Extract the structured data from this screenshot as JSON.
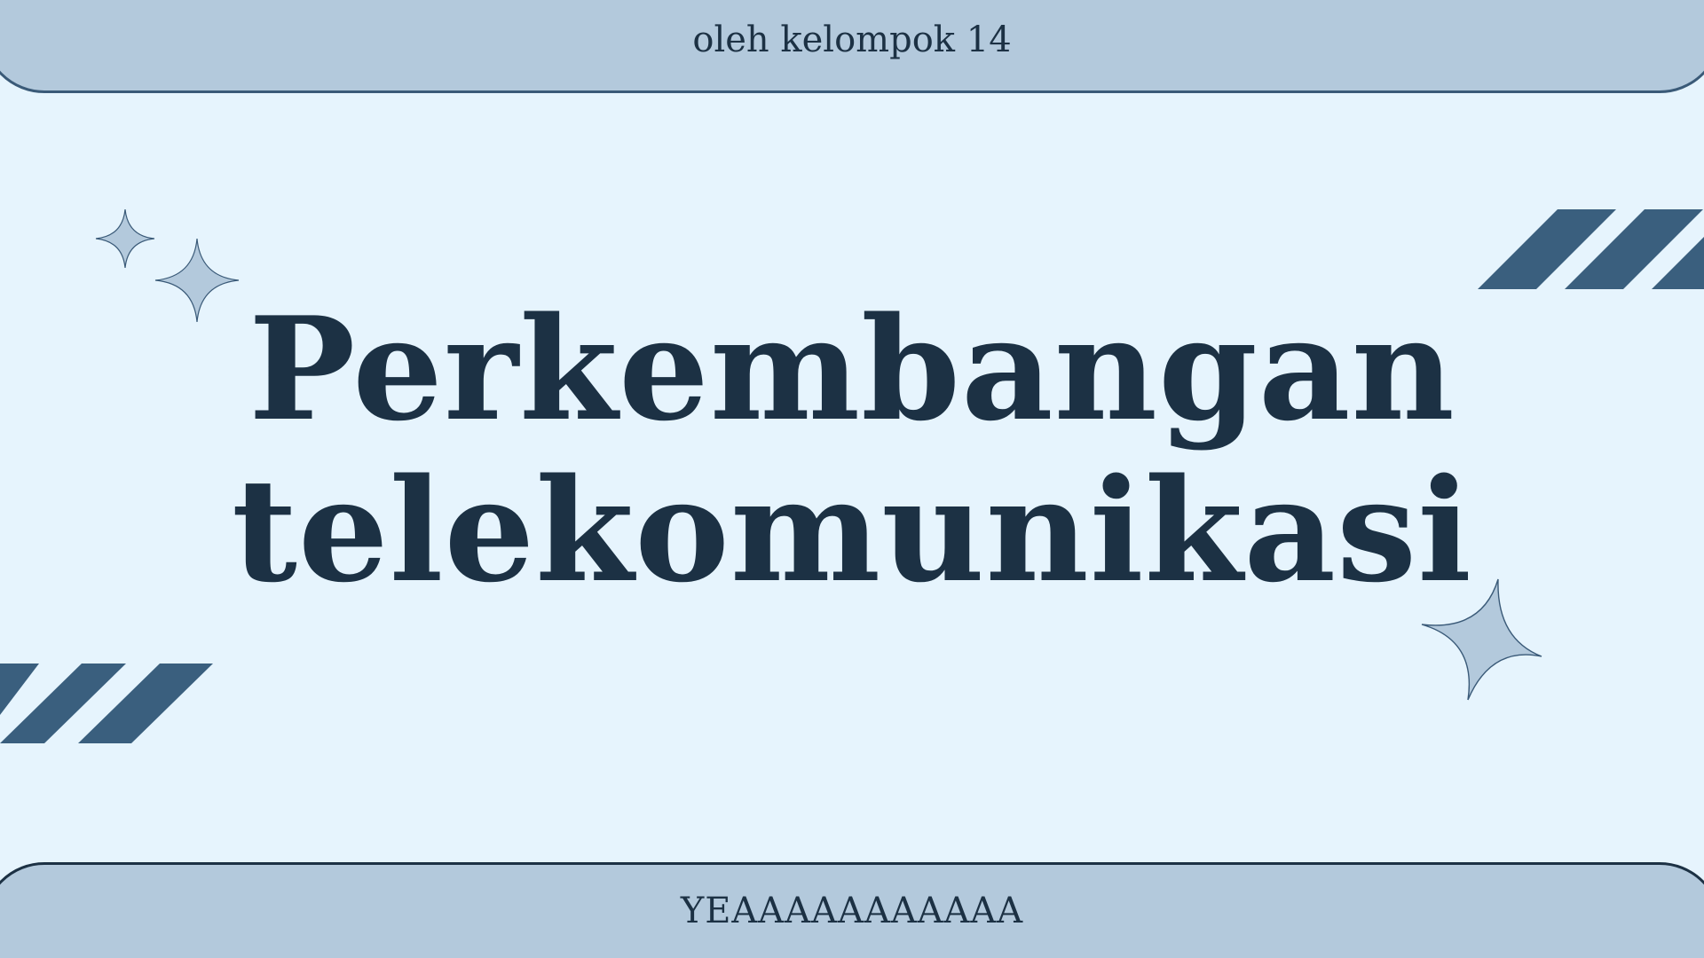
{
  "slide": {
    "subtitle": "oleh kelompok 14",
    "title_line1": "Perkembangan",
    "title_line2": "telekomunikasi",
    "footer": "YEAAAAAAAAAAA"
  },
  "colors": {
    "background": "#e6f4fd",
    "band": "#b3c9dc",
    "stripe": "#3a5f7e",
    "text": "#1c3144"
  },
  "icons": [
    "sparkle-icon",
    "diagonal-stripes"
  ]
}
